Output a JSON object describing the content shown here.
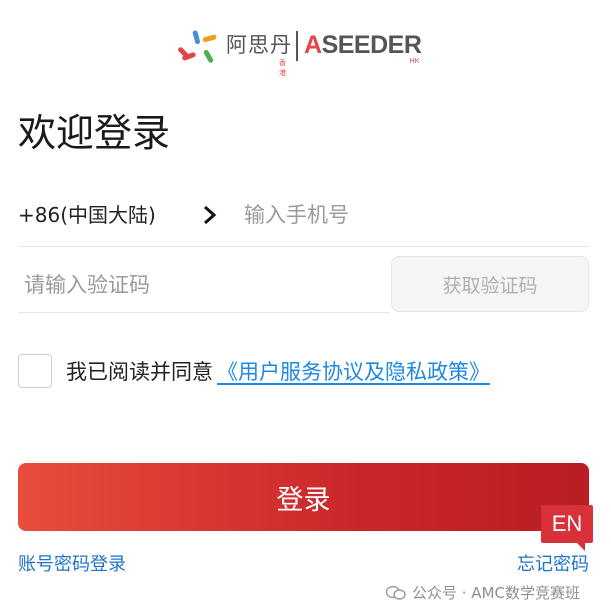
{
  "logo": {
    "name_cn": "阿思丹",
    "name_en_a": "A",
    "name_en_rest": "SEEDER",
    "sub_cn": "香港",
    "sub_en": "HK"
  },
  "title": "欢迎登录",
  "phone": {
    "country_code": "+86(中国大陆)",
    "placeholder": "输入手机号"
  },
  "code": {
    "placeholder": "请输入验证码",
    "get_code_label": "获取验证码"
  },
  "agreement": {
    "text": "我已阅读并同意",
    "link": "《用户服务协议及隐私政策》"
  },
  "login_label": "登录",
  "language_badge": "EN",
  "password_login_label": "账号密码登录",
  "forgot_password_label": "忘记密码",
  "watermark": "公众号 · AMC数学竞赛班",
  "colors": {
    "primary_red": "#d9313a",
    "link_blue": "#1e88e5",
    "placeholder_gray": "#9a9a9a"
  }
}
